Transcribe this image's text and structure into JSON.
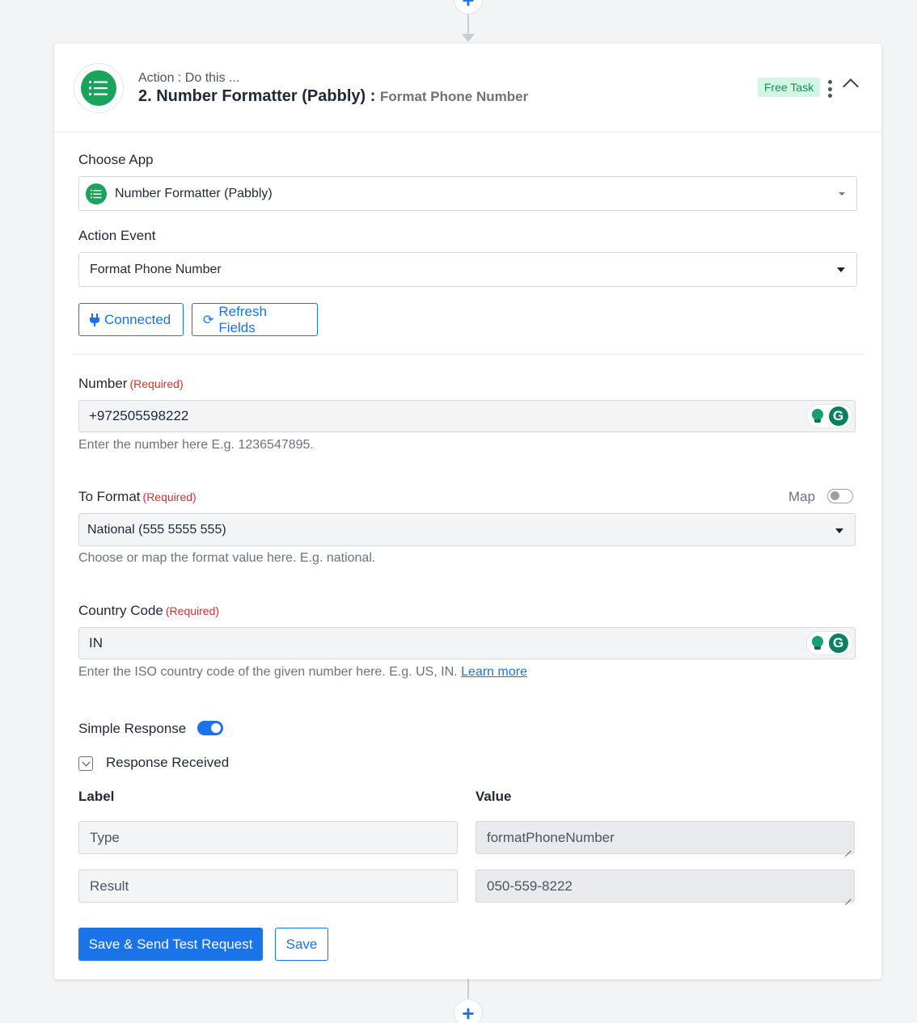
{
  "workflow": {
    "add_step_symbol": "+"
  },
  "header": {
    "action_prefix": "Action : Do this ...",
    "title_step": "2. Number Formatter (Pabbly) :",
    "title_event": "Format Phone Number",
    "badge": "Free Task",
    "brand_color": "#1aa35a"
  },
  "choose_app": {
    "label": "Choose App",
    "value": "Number Formatter (Pabbly)"
  },
  "action_event": {
    "label": "Action Event",
    "value": "Format Phone Number"
  },
  "buttons": {
    "connected": "Connected",
    "refresh": "Refresh Fields",
    "save_send": "Save & Send Test Request",
    "save": "Save"
  },
  "fields": {
    "required_text": "(Required)",
    "number": {
      "label": "Number",
      "value": "+972505598222",
      "hint": "Enter the number here E.g. 1236547895."
    },
    "to_format": {
      "label": "To Format",
      "map_label": "Map",
      "value": "National (555 5555 555)",
      "hint": "Choose or map the format value here. E.g. national."
    },
    "country_code": {
      "label": "Country Code",
      "value": "IN",
      "hint": "Enter the ISO country code of the given number here. E.g. US, IN.",
      "link": "Learn more"
    }
  },
  "simple_response": {
    "label": "Simple Response"
  },
  "response_received": {
    "label": "Response Received",
    "col_label": "Label",
    "col_value": "Value",
    "rows": [
      {
        "label": "Type",
        "value": "formatPhoneNumber"
      },
      {
        "label": "Result",
        "value": "050-559-8222"
      }
    ]
  },
  "colors": {
    "accent": "#1a73e8",
    "required": "#d32f2f",
    "badge_bg": "#d3f5e3"
  }
}
